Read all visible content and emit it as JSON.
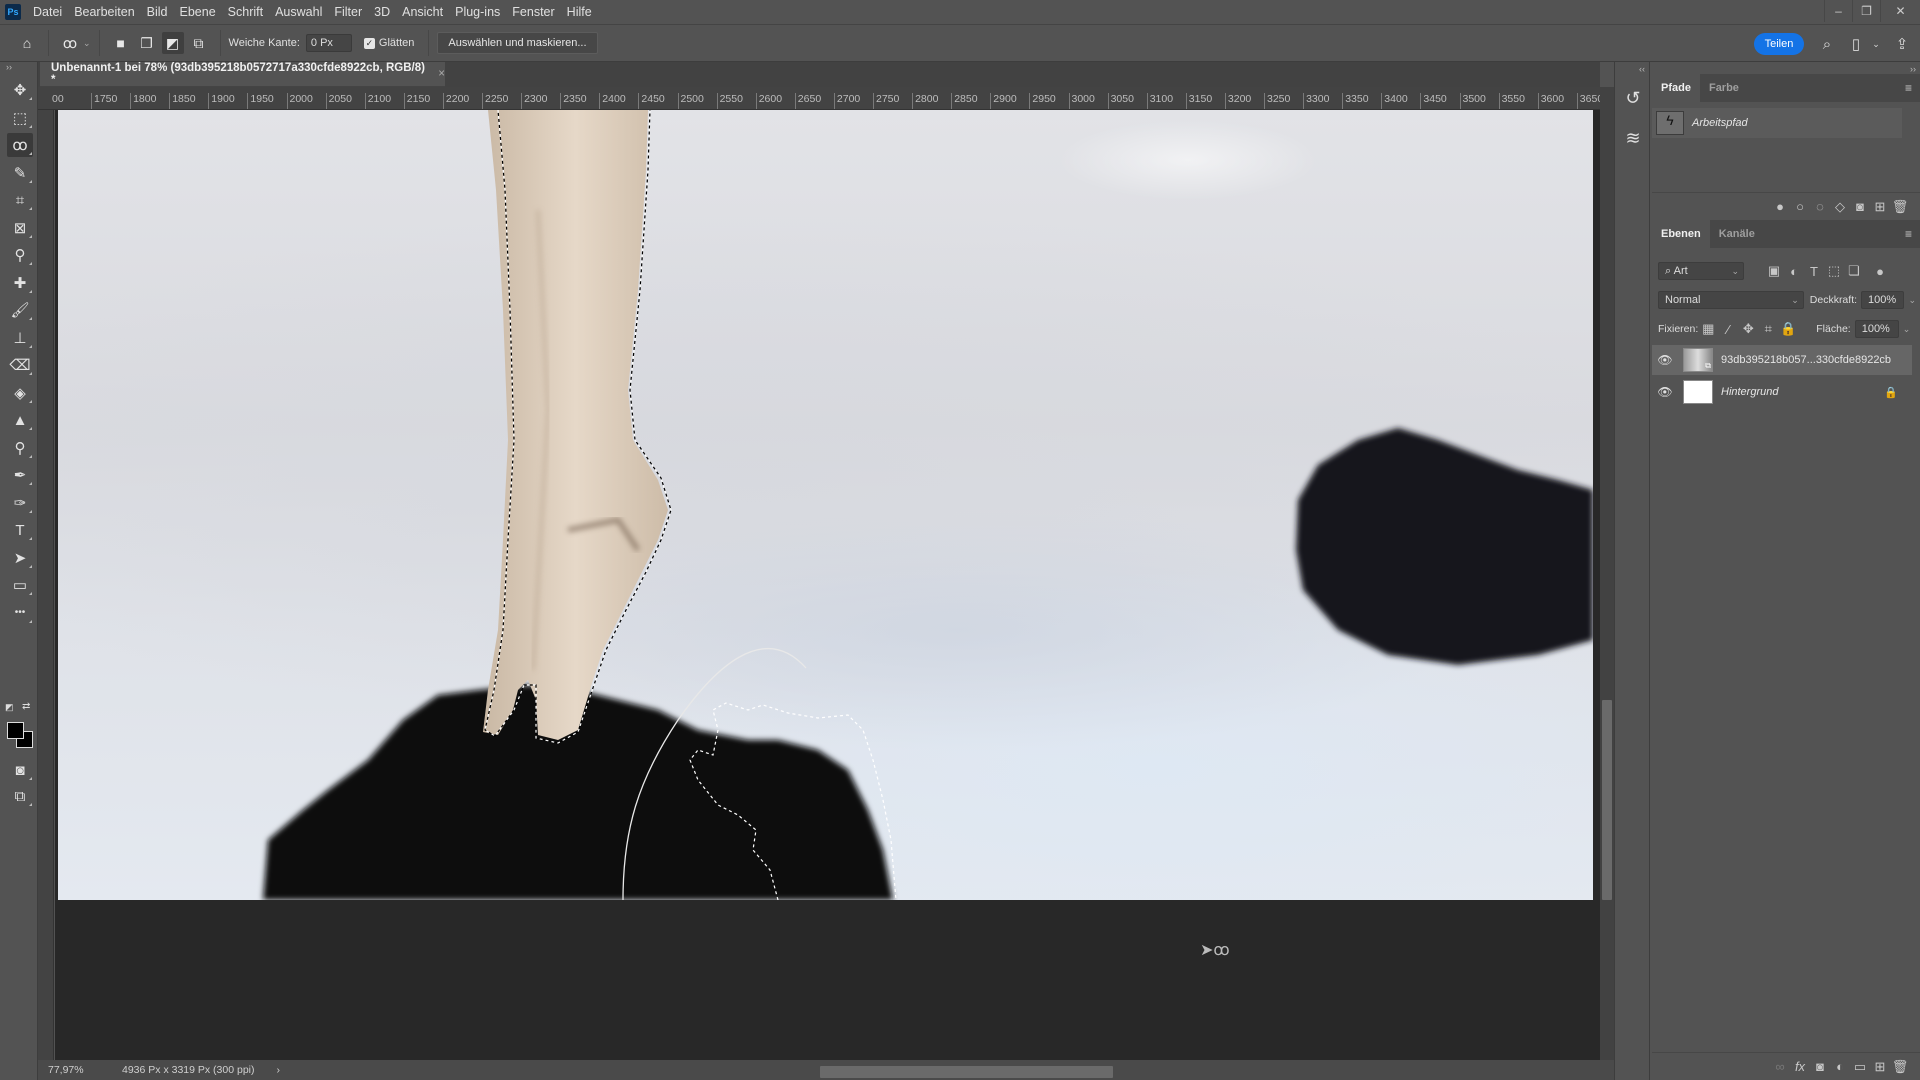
{
  "app": {
    "logo": "Ps"
  },
  "menu": [
    "Datei",
    "Bearbeiten",
    "Bild",
    "Ebene",
    "Schrift",
    "Auswahl",
    "Filter",
    "3D",
    "Ansicht",
    "Plug-ins",
    "Fenster",
    "Hilfe"
  ],
  "window_controls": {
    "minimize": "–",
    "restore": "❐",
    "close": "✕"
  },
  "options_bar": {
    "feather_label": "Weiche Kante:",
    "feather_value": "0 Px",
    "antialias_label": "Glätten",
    "antialias_checked": true,
    "select_mask_button": "Auswählen und maskieren...",
    "share_button": "Teilen"
  },
  "document": {
    "tab_title": "Unbenannt-1 bei 78% (93db395218b0572717a330cfde8922cb, RGB/8) *",
    "close": "×"
  },
  "ruler_labels": [
    "00",
    "1750",
    "1800",
    "1850",
    "1900",
    "1950",
    "2000",
    "2050",
    "2100",
    "2150",
    "2200",
    "2250",
    "2300",
    "2350",
    "2400",
    "2450",
    "2500",
    "2550",
    "2600",
    "2650",
    "2700",
    "2750",
    "2800",
    "2850",
    "2900",
    "2950",
    "3000",
    "3050",
    "3100",
    "3150",
    "3200",
    "3250",
    "3300",
    "3350",
    "3400",
    "3450",
    "3500",
    "3550",
    "3600",
    "3650"
  ],
  "status": {
    "zoom": "77,97%",
    "doc_info": "4936 Px x 3319 Px (300 ppi)",
    "arrow": "›"
  },
  "tools": [
    {
      "name": "move-tool",
      "glyph": "✥"
    },
    {
      "name": "marquee-tool",
      "glyph": "⬚"
    },
    {
      "name": "lasso-tool",
      "glyph": "ꝏ",
      "active": true
    },
    {
      "name": "quick-selection-tool",
      "glyph": "✎"
    },
    {
      "name": "crop-tool",
      "glyph": "⌗"
    },
    {
      "name": "frame-tool",
      "glyph": "⊠"
    },
    {
      "name": "eyedropper-tool",
      "glyph": "⚲"
    },
    {
      "name": "healing-brush-tool",
      "glyph": "✚"
    },
    {
      "name": "brush-tool",
      "glyph": "🖌"
    },
    {
      "name": "clone-stamp-tool",
      "glyph": "⊥"
    },
    {
      "name": "eraser-tool",
      "glyph": "⌫"
    },
    {
      "name": "paint-bucket-tool",
      "glyph": "◈"
    },
    {
      "name": "sharpen-tool",
      "glyph": "▲"
    },
    {
      "name": "dodge-tool",
      "glyph": "⚲"
    },
    {
      "name": "pen-tool",
      "glyph": "✒"
    },
    {
      "name": "freeform-pen-tool",
      "glyph": "✑"
    },
    {
      "name": "type-tool",
      "glyph": "T"
    },
    {
      "name": "path-selection-tool",
      "glyph": "➤"
    },
    {
      "name": "rectangle-tool",
      "glyph": "▭"
    },
    {
      "name": "more-tools",
      "glyph": "•••"
    }
  ],
  "paths_panel": {
    "tabs": [
      "Pfade",
      "Farbe"
    ],
    "active_tab": "Pfade",
    "items": [
      {
        "name": "Arbeitspfad"
      }
    ]
  },
  "layers_panel": {
    "tabs": [
      "Ebenen",
      "Kanäle"
    ],
    "active_tab": "Ebenen",
    "filter_label": "Art",
    "blend_mode": "Normal",
    "opacity_label": "Deckkraft:",
    "opacity_value": "100%",
    "lock_label": "Fixieren:",
    "fill_label": "Fläche:",
    "fill_value": "100%",
    "layers": [
      {
        "name": "93db395218b057...330cfde8922cb",
        "visible": true,
        "selected": true,
        "smart_object": true
      },
      {
        "name": "Hintergrund",
        "visible": true,
        "locked": true,
        "italic": true
      }
    ]
  }
}
